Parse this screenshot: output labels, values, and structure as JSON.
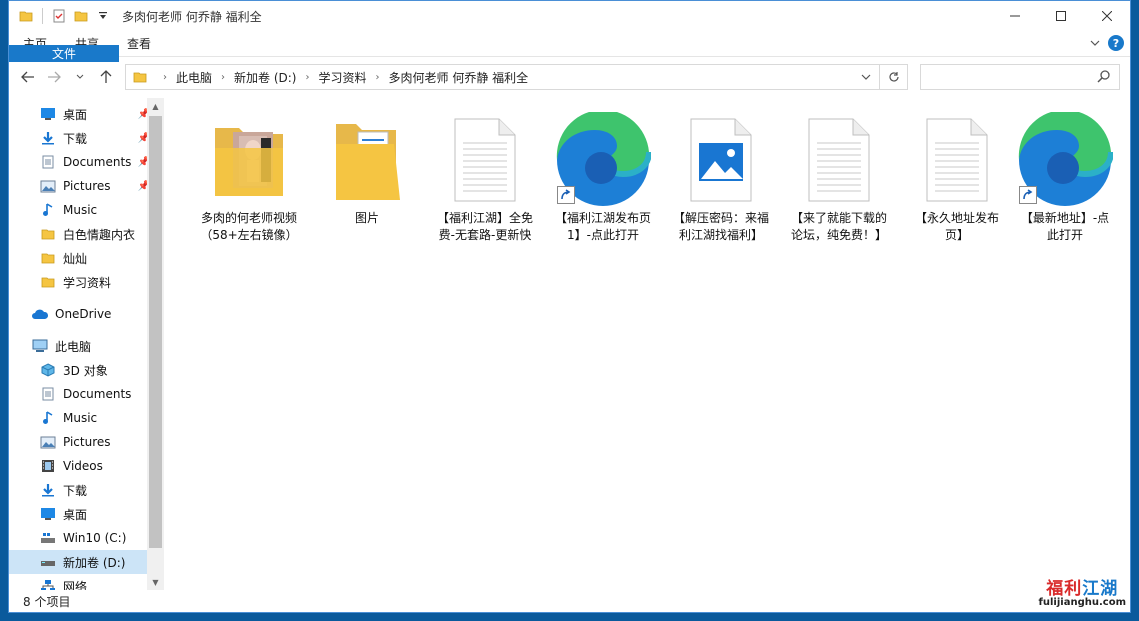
{
  "window": {
    "title": "多肉何老师 何乔静 福利全"
  },
  "ribbon": {
    "tabs": [
      "文件",
      "主页",
      "共享",
      "查看"
    ]
  },
  "address": {
    "crumbs": [
      "此电脑",
      "新加卷 (D:)",
      "学习资料",
      "多肉何老师 何乔静 福利全"
    ]
  },
  "search": {
    "placeholder": ""
  },
  "sidebar": {
    "quick_access": [
      {
        "label": "桌面",
        "icon": "desktop-icon",
        "pinned": true
      },
      {
        "label": "下载",
        "icon": "download-icon",
        "pinned": true
      },
      {
        "label": "Documents",
        "icon": "documents-icon",
        "pinned": true
      },
      {
        "label": "Pictures",
        "icon": "pictures-icon",
        "pinned": true
      },
      {
        "label": "Music",
        "icon": "music-icon",
        "pinned": false
      },
      {
        "label": "白色情趣内衣",
        "icon": "folder-icon",
        "pinned": false
      },
      {
        "label": "灿灿",
        "icon": "folder-icon",
        "pinned": false
      },
      {
        "label": "学习资料",
        "icon": "folder-icon",
        "pinned": false
      }
    ],
    "onedrive": "OneDrive",
    "this_pc": "此电脑",
    "pc_items": [
      {
        "label": "3D 对象",
        "icon": "3d-objects-icon"
      },
      {
        "label": "Documents",
        "icon": "documents-icon"
      },
      {
        "label": "Music",
        "icon": "music-icon"
      },
      {
        "label": "Pictures",
        "icon": "pictures-icon"
      },
      {
        "label": "Videos",
        "icon": "videos-icon"
      },
      {
        "label": "下载",
        "icon": "download-icon"
      },
      {
        "label": "桌面",
        "icon": "desktop-icon"
      },
      {
        "label": "Win10 (C:)",
        "icon": "drive-icon"
      },
      {
        "label": "新加卷 (D:)",
        "icon": "drive-icon",
        "selected": true
      },
      {
        "label": "网络",
        "icon": "network-icon"
      }
    ]
  },
  "files": [
    {
      "label": "多肉的何老师视频（58+左右镜像）",
      "type": "folder-photo"
    },
    {
      "label": "图片",
      "type": "folder-docs"
    },
    {
      "label": "【福利江湖】全免费-无套路-更新快",
      "type": "document"
    },
    {
      "label": "【福利江湖发布页1】-点此打开",
      "type": "edge-shortcut"
    },
    {
      "label": "【解压密码：来福利江湖找福利】",
      "type": "image-file"
    },
    {
      "label": "【来了就能下载的论坛，纯免费！】",
      "type": "document"
    },
    {
      "label": "【永久地址发布页】",
      "type": "document"
    },
    {
      "label": "【最新地址】-点此打开",
      "type": "edge-shortcut"
    }
  ],
  "status": {
    "count": "8 个项目"
  },
  "watermark": {
    "logo_a": "福利",
    "logo_b": "江湖",
    "url": "fulijianghu.com"
  }
}
